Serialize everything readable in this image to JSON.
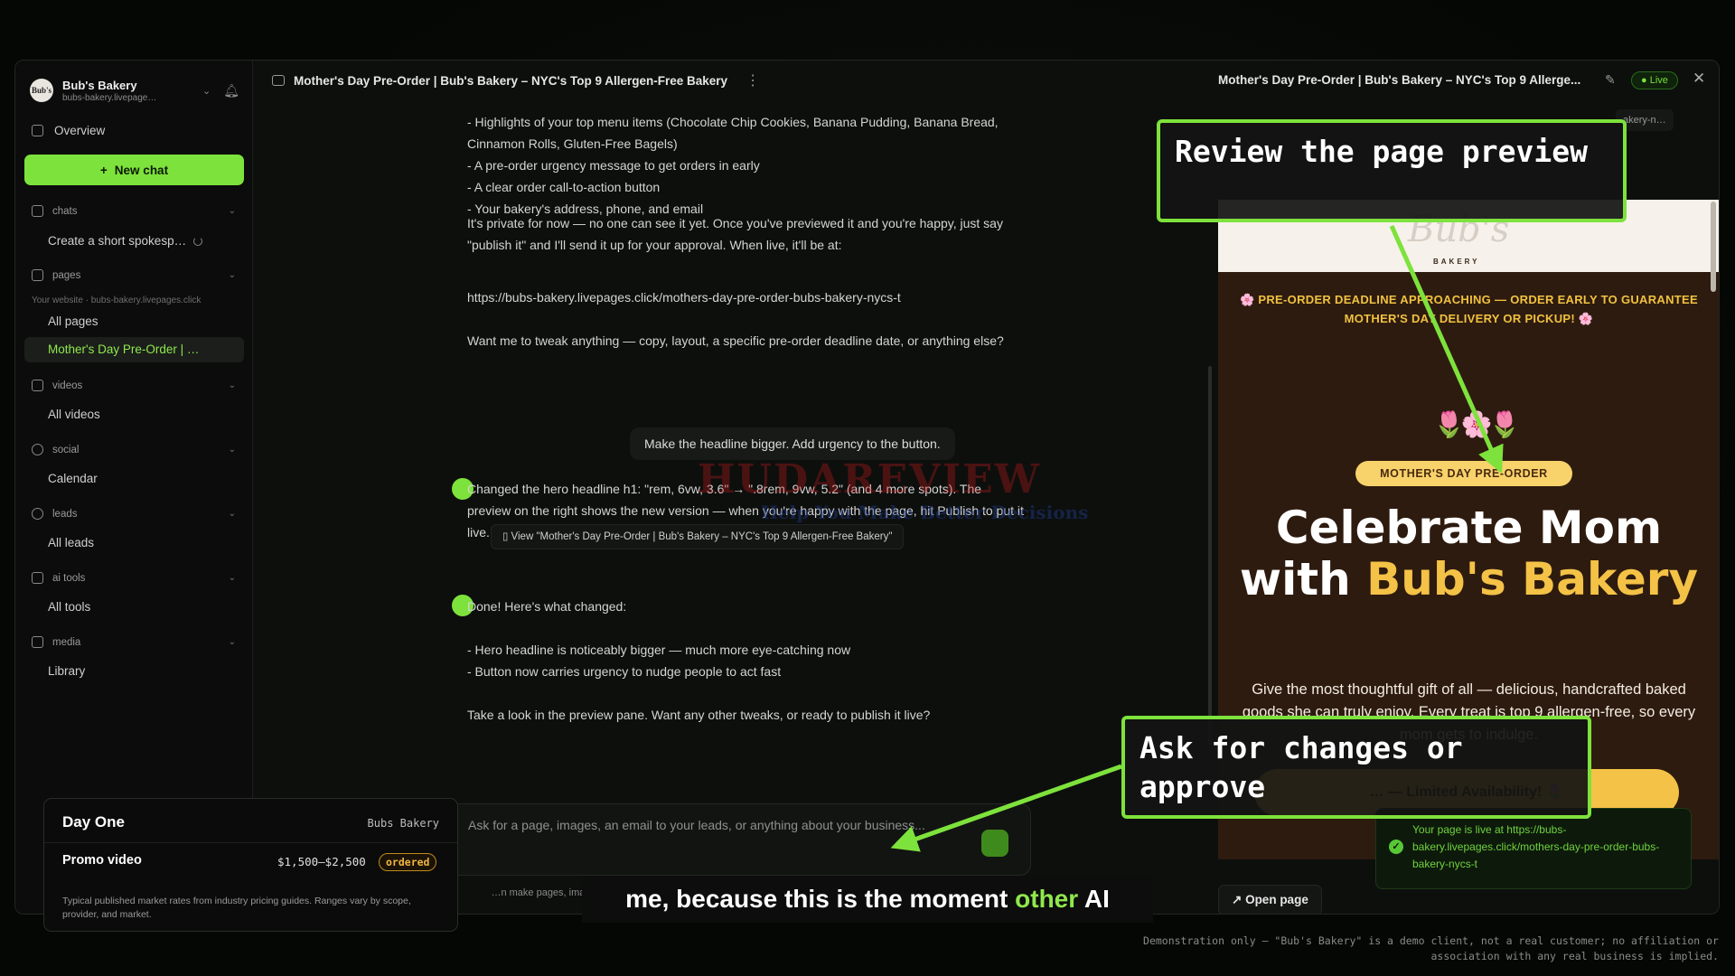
{
  "workspace": {
    "name": "Bub's Bakery",
    "subdomain": "bubs-bakery.livepage…",
    "avatar_text": "Bub's"
  },
  "sidebar": {
    "overview": "Overview",
    "new_chat": "New chat",
    "chats": {
      "label": "chats",
      "items": [
        "Create a short spokesp…"
      ]
    },
    "pages": {
      "label": "pages",
      "site_url": "Your website · bubs-bakery.livepages.click",
      "items": [
        "All pages",
        "Mother's Day Pre-Order | …"
      ]
    },
    "videos": {
      "label": "videos",
      "items": [
        "All videos"
      ]
    },
    "social": {
      "label": "social",
      "items": [
        "Calendar"
      ]
    },
    "leads": {
      "label": "leads",
      "items": [
        "All leads"
      ]
    },
    "ai_tools": {
      "label": "ai tools",
      "items": [
        "All tools"
      ]
    },
    "media": {
      "label": "media",
      "items": [
        "Library"
      ]
    }
  },
  "topbar": {
    "chat_title": "Mother's Day Pre-Order | Bub's Bakery – NYC's Top 9 Allergen-Free Bakery",
    "preview_title": "Mother's Day Pre-Order | Bub's Bakery – NYC's Top 9 Allerge...",
    "live_label": "Live"
  },
  "chat": {
    "msg1": "- Highlights of your top menu items (Chocolate Chip Cookies, Banana Pudding, Banana Bread, Cinnamon Rolls, Gluten-Free Bagels)\n- A pre-order urgency message to get orders in early\n- A clear order call-to-action button\n- Your bakery's address, phone, and email",
    "msg2": "It's private for now — no one can see it yet. Once you've previewed it and you're happy, just say \"publish it\" and I'll send it up for your approval. When live, it'll be at:",
    "msg3": "https://bubs-bakery.livepages.click/mothers-day-pre-order-bubs-bakery-nycs-t",
    "msg4": "Want me to tweak anything — copy, layout, a specific pre-order deadline date, or anything else?",
    "user_msg": "Make the headline bigger. Add urgency to the button.",
    "ai1": "Changed the hero headline h1: \"rem, 6vw, 3.6\" → \".8rem, 9vw, 5.2\" (and 4 more spots). The preview on the right shows the new version — when you're happy with the page, hit Publish to put it live.",
    "view_chip": "View \"Mother's Day Pre-Order | Bub's Bakery – NYC's Top 9 Allergen-Free Bakery\"",
    "ai2_title": "Done! Here's what changed:",
    "ai2_list": "- Hero headline is noticeably bigger — much more eye-catching now\n- Button now carries urgency to nudge people to act fast",
    "ai2_end": "Take a look in the preview pane. Want any other tweaks, or ready to publish it live?",
    "composer_placeholder": "Ask for a page, images, an email to your leads, or anything about your business...",
    "disclaimer": "…n make pages, images, and videos, manage your leads, and draft emails — upload a talking-head clip for a spokesperson video; nothing sends without your OK."
  },
  "preview": {
    "url_chip": "akery-n…",
    "logo": "Bub's",
    "bakery_tag": "BAKERY",
    "deadline": "🌸 PRE-ORDER DEADLINE APPROACHING — ORDER EARLY TO GUARANTEE MOTHER'S DAY DELIVERY OR PICKUP! 🌸",
    "flowers": "🌷🌸🌷",
    "badge": "MOTHER'S DAY PRE-ORDER",
    "hero_line1": "Celebrate Mom",
    "hero_with": "with ",
    "hero_gold": "Bub's Bakery",
    "body": "Give the most thoughtful gift of all — delicious, handcrafted baked goods she can truly enjoy. Every treat is top 9 allergen-free, so every mom gets to indulge.",
    "cta": "… — Limited Availability! 🌷",
    "open_page": "Open page",
    "toast": "Your page is live at https://bubs-bakery.livepages.click/mothers-day-pre-order-bubs-bakery-nycs-t"
  },
  "cost_card": {
    "title": "Day One",
    "client": "Bubs Bakery",
    "item": "Promo video",
    "price": "$1,500–$2,500",
    "status": "ordered",
    "note": "Typical published market rates from industry pricing guides. Ranges vary by scope, provider, and market."
  },
  "callouts": {
    "review": "Review the page preview",
    "ask": "Ask for changes or approve"
  },
  "subtitle": {
    "before": "me, because this is the moment ",
    "accent": "other",
    "after": " AI"
  },
  "watermark": {
    "main": "HUDAREVIEW",
    "tagline": "Help You Make Better Decisions"
  },
  "demo_note": "Demonstration only — \"Bub's Bakery\" is a demo client, not a real customer; no affiliation or association with any real business is implied.",
  "colors": {
    "accent": "#7ee23c",
    "preview_bg": "#2e1b0f",
    "gold": "#f4c246"
  }
}
